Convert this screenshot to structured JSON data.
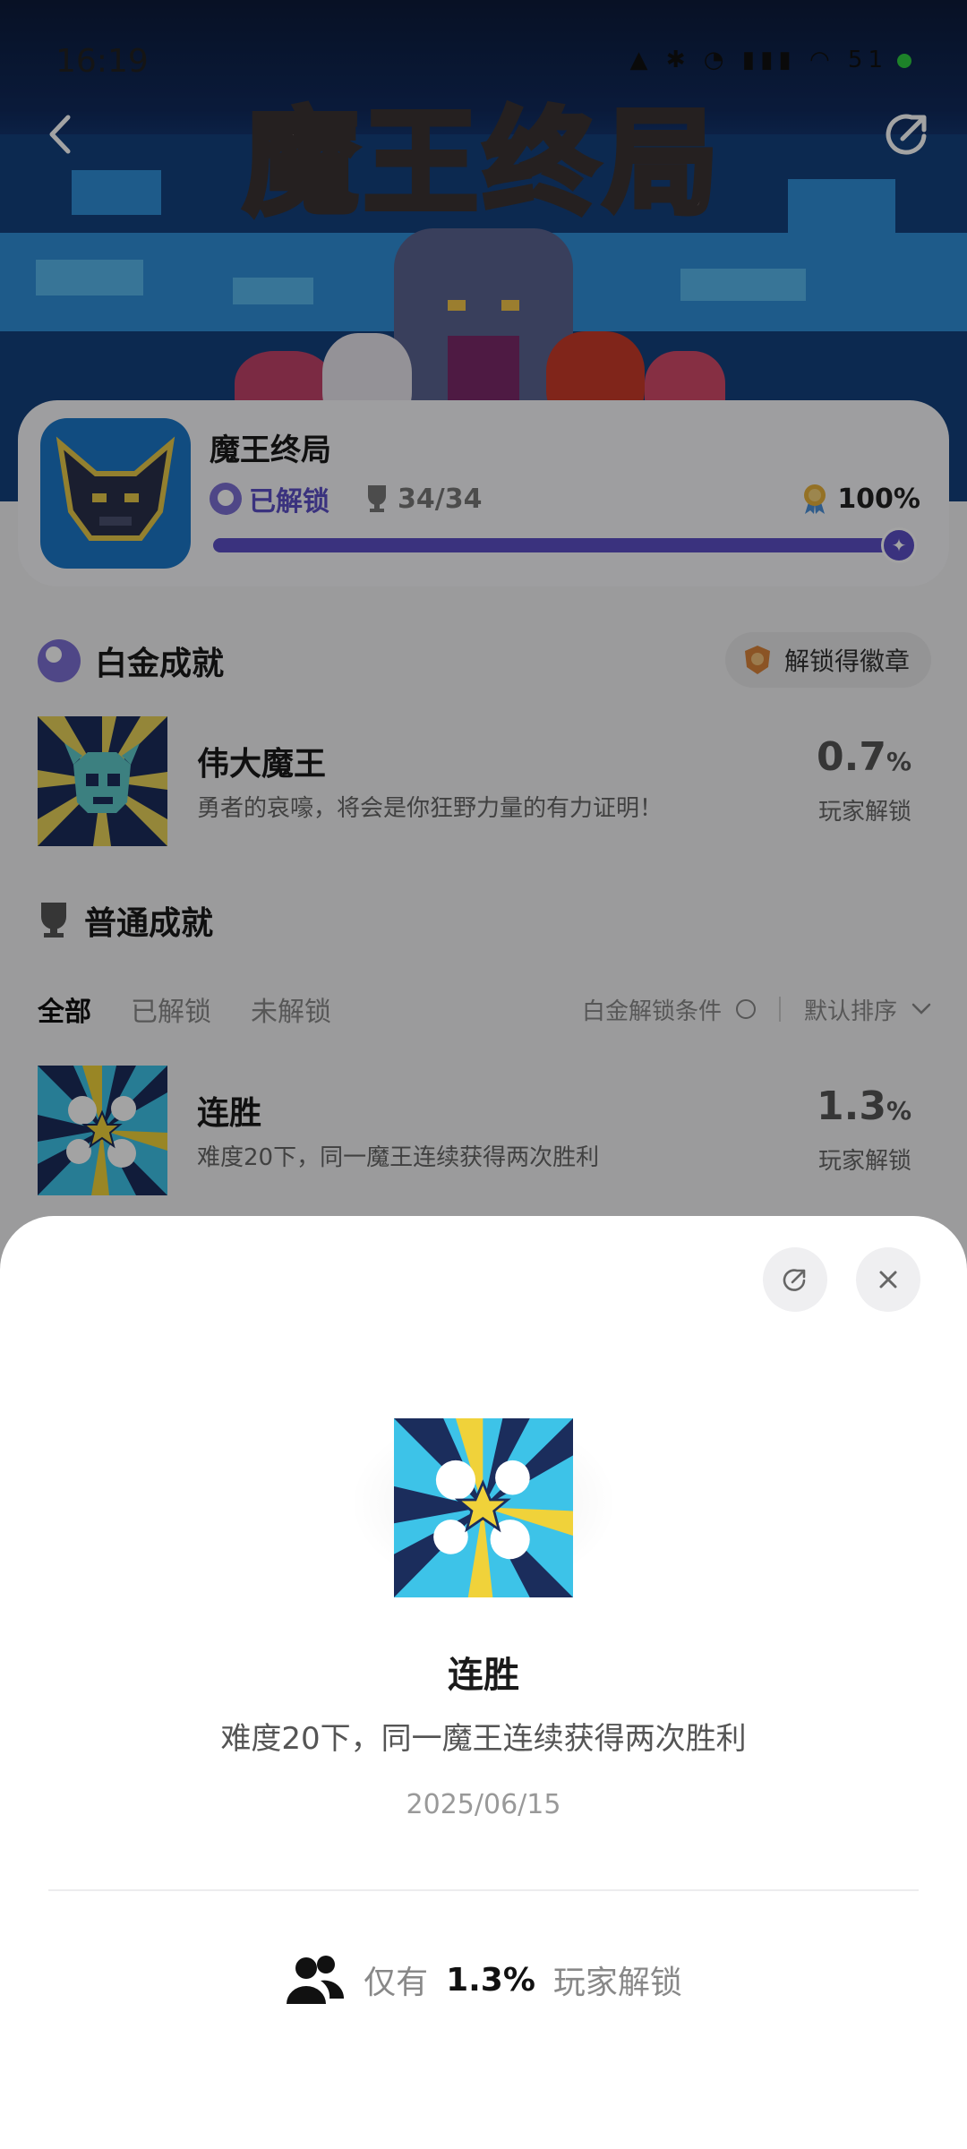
{
  "status_bar": {
    "time": "16:19",
    "battery": "51"
  },
  "header": {
    "game_logo_text": "魔王终局"
  },
  "game_card": {
    "title": "魔王终局",
    "unlocked_label": "已解锁",
    "trophy_count": "34/34",
    "completion_percent": "100%",
    "progress_fraction": 1.0
  },
  "platinum": {
    "section_title": "白金成就",
    "badge_label": "解锁得徽章",
    "achievement": {
      "name": "伟大魔王",
      "description": "勇者的哀嚎，将会是你狂野力量的有力证明！",
      "percent": "0.7",
      "percent_unit": "%",
      "percent_label": "玩家解锁"
    }
  },
  "normal": {
    "section_title": "普通成就",
    "tabs": [
      "全部",
      "已解锁",
      "未解锁"
    ],
    "active_tab": "全部",
    "platinum_filter_label": "白金解锁条件",
    "sort_label": "默认排序",
    "achievements": [
      {
        "name": "连胜",
        "description": "难度20下，同一魔王连续获得两次胜利",
        "percent": "1.3",
        "percent_unit": "%",
        "percent_label": "玩家解锁"
      }
    ]
  },
  "sheet": {
    "title": "连胜",
    "description": "难度20下，同一魔王连续获得两次胜利",
    "date": "2025/06/15",
    "stat_prefix": "仅有",
    "stat_value": "1.3%",
    "stat_suffix": "玩家解锁"
  },
  "colors": {
    "accent": "#5b4fc6",
    "text_primary": "#1a1a1a",
    "text_secondary": "#666666"
  },
  "icons": [
    "back-icon",
    "share-icon",
    "ghost-icon",
    "trophy-icon",
    "medal-icon",
    "badge-icon",
    "chevron-down-icon",
    "close-icon",
    "users-icon"
  ]
}
